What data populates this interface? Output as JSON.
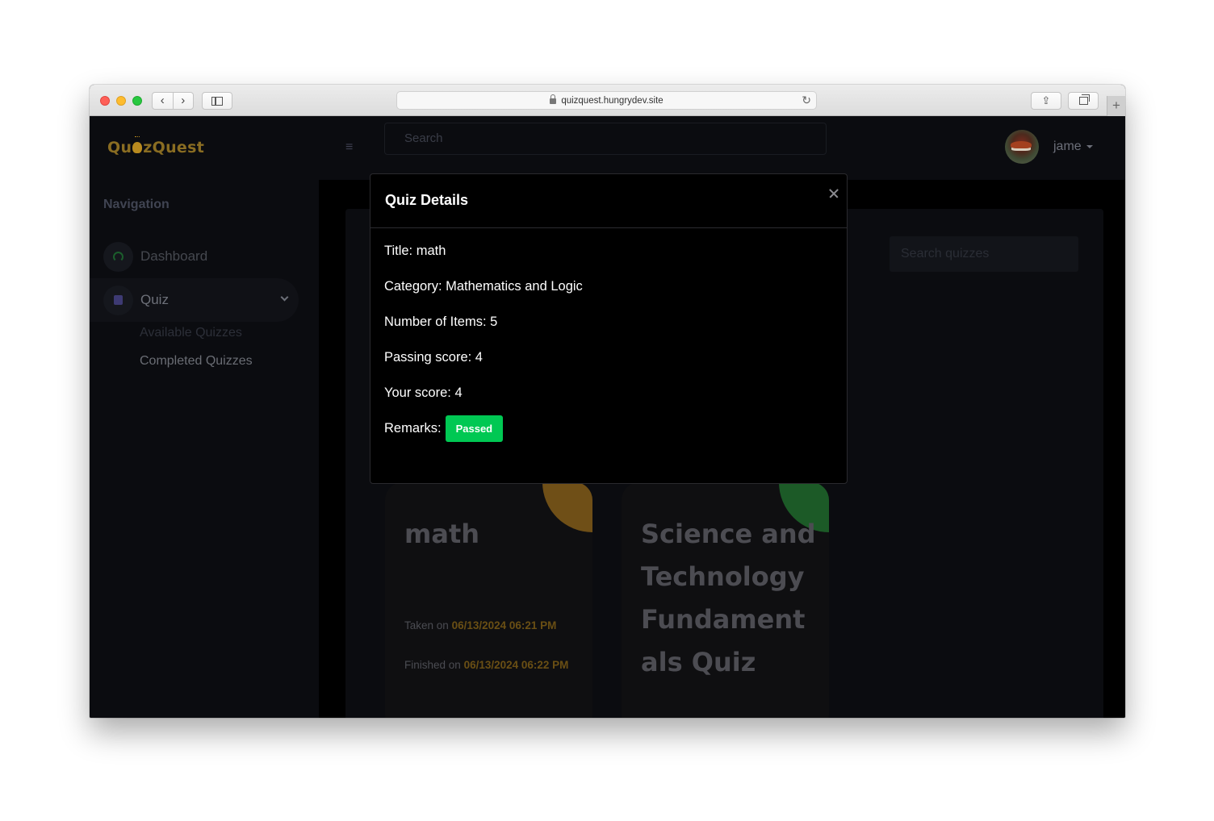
{
  "browser": {
    "url": "quizquest.hungrydev.site",
    "nav_back": "‹",
    "nav_forward": "›",
    "reload": "↻",
    "new_tab": "+"
  },
  "app": {
    "logo_left": "Qu",
    "logo_right": "zQuest",
    "search_placeholder": "Search",
    "user_name": "jame"
  },
  "sidebar": {
    "title": "Navigation",
    "items": [
      {
        "label": "Dashboard",
        "icon": "gauge-icon"
      },
      {
        "label": "Quiz",
        "icon": "document-icon"
      }
    ],
    "sub_items": [
      "Available Quizzes",
      "Completed Quizzes"
    ]
  },
  "main": {
    "search_placeholder": "Search quizzes",
    "cards": [
      {
        "title": "math",
        "taken_prefix": "Taken on",
        "taken_date": "06/13/2024 06:21 PM",
        "finished_prefix": "Finished on",
        "finished_date": "06/13/2024 06:22 PM",
        "accent": "#6f4f17"
      },
      {
        "title": "Science and Technology Fundament als Quiz",
        "accent": "#1c5a27"
      }
    ]
  },
  "modal": {
    "title": "Quiz Details",
    "title_line": "Title: math",
    "category_line": "Category: Mathematics and Logic",
    "items_line": "Number of Items: 5",
    "passing_line": "Passing score: 4",
    "score_line": "Your score: 4",
    "remarks_label": "Remarks:",
    "remarks_badge": "Passed",
    "badge_color": "#00c853"
  }
}
